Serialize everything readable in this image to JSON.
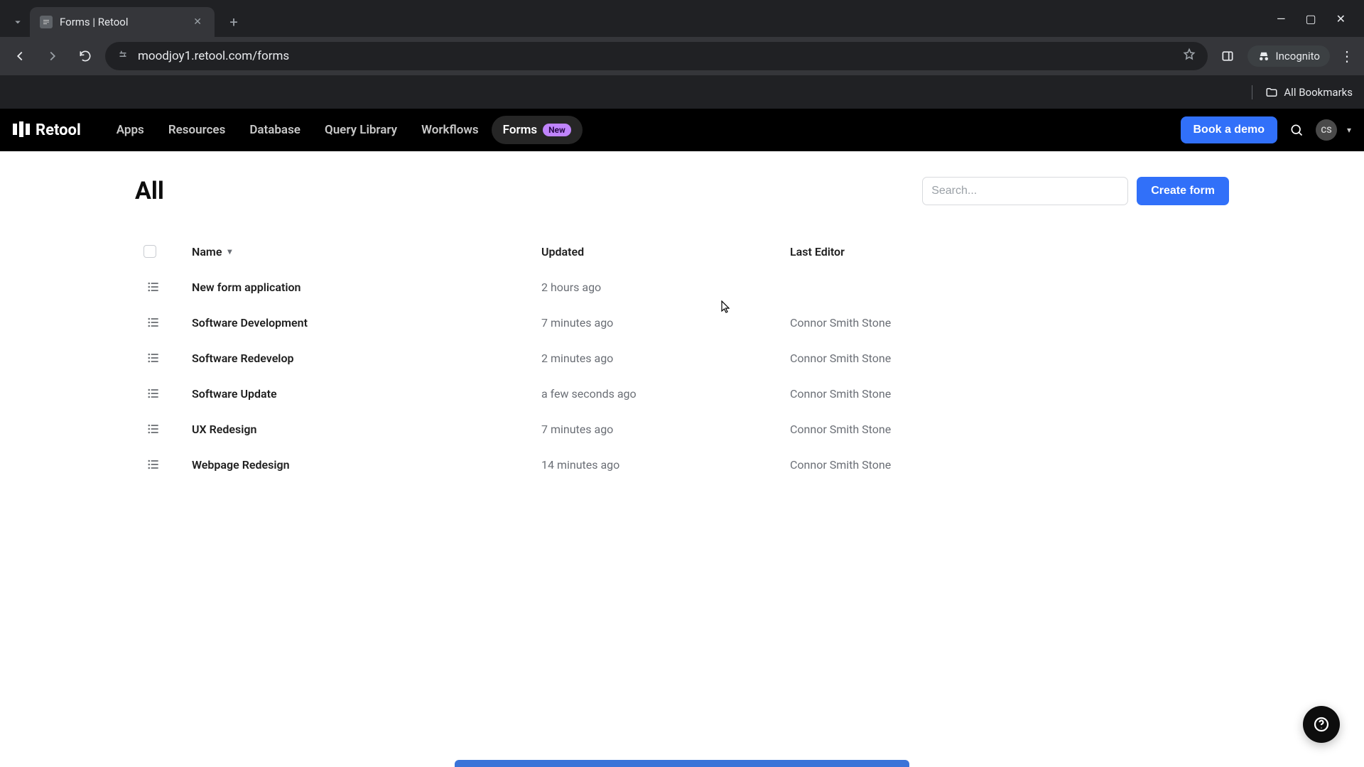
{
  "browser": {
    "tab_title": "Forms | Retool",
    "url": "moodjoy1.retool.com/forms",
    "incognito_label": "Incognito",
    "all_bookmarks": "All Bookmarks"
  },
  "header": {
    "brand": "Retool",
    "nav": {
      "apps": "Apps",
      "resources": "Resources",
      "database": "Database",
      "query_library": "Query Library",
      "workflows": "Workflows",
      "forms": "Forms",
      "forms_badge": "New"
    },
    "demo_button": "Book a demo",
    "avatar_initials": "CS"
  },
  "page": {
    "title": "All",
    "search_placeholder": "Search...",
    "create_button": "Create form",
    "columns": {
      "name": "Name",
      "updated": "Updated",
      "last_editor": "Last Editor"
    },
    "rows": [
      {
        "name": "New form application",
        "updated": "2 hours ago",
        "editor": ""
      },
      {
        "name": "Software Development",
        "updated": "7 minutes ago",
        "editor": "Connor Smith Stone"
      },
      {
        "name": "Software Redevelop",
        "updated": "2 minutes ago",
        "editor": "Connor Smith Stone"
      },
      {
        "name": "Software Update",
        "updated": "a few seconds ago",
        "editor": "Connor Smith Stone"
      },
      {
        "name": "UX Redesign",
        "updated": "7 minutes ago",
        "editor": "Connor Smith Stone"
      },
      {
        "name": "Webpage Redesign",
        "updated": "14 minutes ago",
        "editor": "Connor Smith Stone"
      }
    ]
  }
}
